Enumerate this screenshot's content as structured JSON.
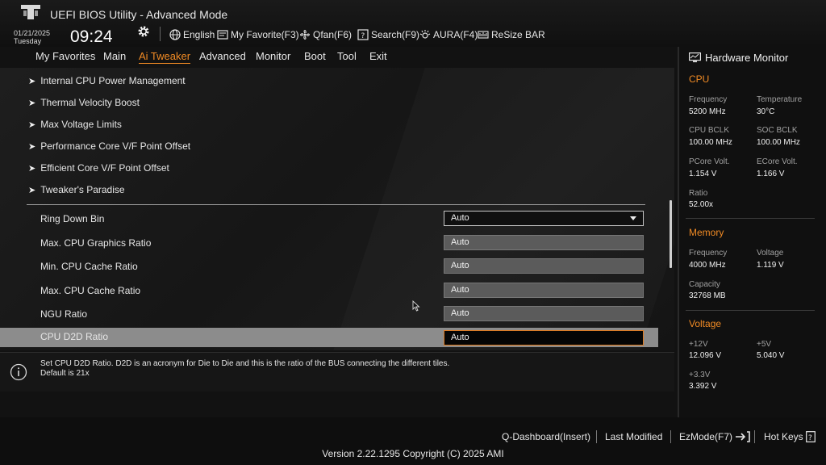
{
  "header": {
    "title": "UEFI BIOS Utility - Advanced Mode",
    "date": "01/21/2025",
    "day": "Tuesday",
    "time": "09:24",
    "tools": [
      {
        "label": "English",
        "icon": "globe-icon"
      },
      {
        "label": "My Favorite(F3)",
        "icon": "favorite-icon"
      },
      {
        "label": "Qfan(F6)",
        "icon": "fan-icon"
      },
      {
        "label": "Search(F9)",
        "icon": "search-icon"
      },
      {
        "label": "AURA(F4)",
        "icon": "aura-icon"
      },
      {
        "label": "ReSize BAR",
        "icon": "resize-bar-icon"
      }
    ]
  },
  "nav": {
    "items": [
      "My Favorites",
      "Main",
      "Ai Tweaker",
      "Advanced",
      "Monitor",
      "Boot",
      "Tool",
      "Exit"
    ],
    "active": "Ai Tweaker"
  },
  "main": {
    "submenus": [
      "Internal CPU Power Management",
      "Thermal Velocity Boost",
      "Max Voltage Limits",
      "Performance Core V/F Point Offset",
      "Efficient Core V/F Point Offset",
      "Tweaker's Paradise"
    ],
    "settings": [
      {
        "label": "Ring Down Bin",
        "value": "Auto",
        "type": "dropdown"
      },
      {
        "label": "Max. CPU Graphics Ratio",
        "value": "Auto",
        "type": "input"
      },
      {
        "label": "Min. CPU Cache Ratio",
        "value": "Auto",
        "type": "input"
      },
      {
        "label": "Max. CPU Cache Ratio",
        "value": "Auto",
        "type": "input"
      },
      {
        "label": "NGU Ratio",
        "value": "Auto",
        "type": "input"
      },
      {
        "label": "CPU D2D Ratio",
        "value": "Auto",
        "type": "input",
        "selected": true
      }
    ]
  },
  "help": {
    "text": "Set CPU D2D Ratio. D2D is an acronym for Die to Die and this is the ratio of the BUS connecting the different tiles.\nDefault is 21x"
  },
  "hardware_monitor": {
    "title": "Hardware Monitor",
    "cpu": {
      "heading": "CPU",
      "frequency_label": "Frequency",
      "frequency": "5200 MHz",
      "temperature_label": "Temperature",
      "temperature": "30°C",
      "cpu_bclk_label": "CPU BCLK",
      "cpu_bclk": "100.00 MHz",
      "soc_bclk_label": "SOC BCLK",
      "soc_bclk": "100.00 MHz",
      "pcore_volt_label": "PCore Volt.",
      "pcore_volt": "1.154 V",
      "ecore_volt_label": "ECore Volt.",
      "ecore_volt": "1.166 V",
      "ratio_label": "Ratio",
      "ratio": "52.00x"
    },
    "memory": {
      "heading": "Memory",
      "frequency_label": "Frequency",
      "frequency": "4000 MHz",
      "voltage_label": "Voltage",
      "voltage": "1.119 V",
      "capacity_label": "Capacity",
      "capacity": "32768 MB"
    },
    "voltage": {
      "heading": "Voltage",
      "v12_label": "+12V",
      "v12": "12.096 V",
      "v5_label": "+5V",
      "v5": "5.040 V",
      "v33_label": "+3.3V",
      "v33": "3.392 V"
    }
  },
  "footer": {
    "q_dashboard": "Q-Dashboard(Insert)",
    "last_modified": "Last Modified",
    "ezmode": "EzMode(F7)",
    "hot_keys": "Hot Keys",
    "version": "Version 2.22.1295 Copyright (C) 2025 AMI"
  },
  "colors": {
    "accent": "#f08a24",
    "selected_row": "#8c8c8c",
    "background": "#121212"
  }
}
